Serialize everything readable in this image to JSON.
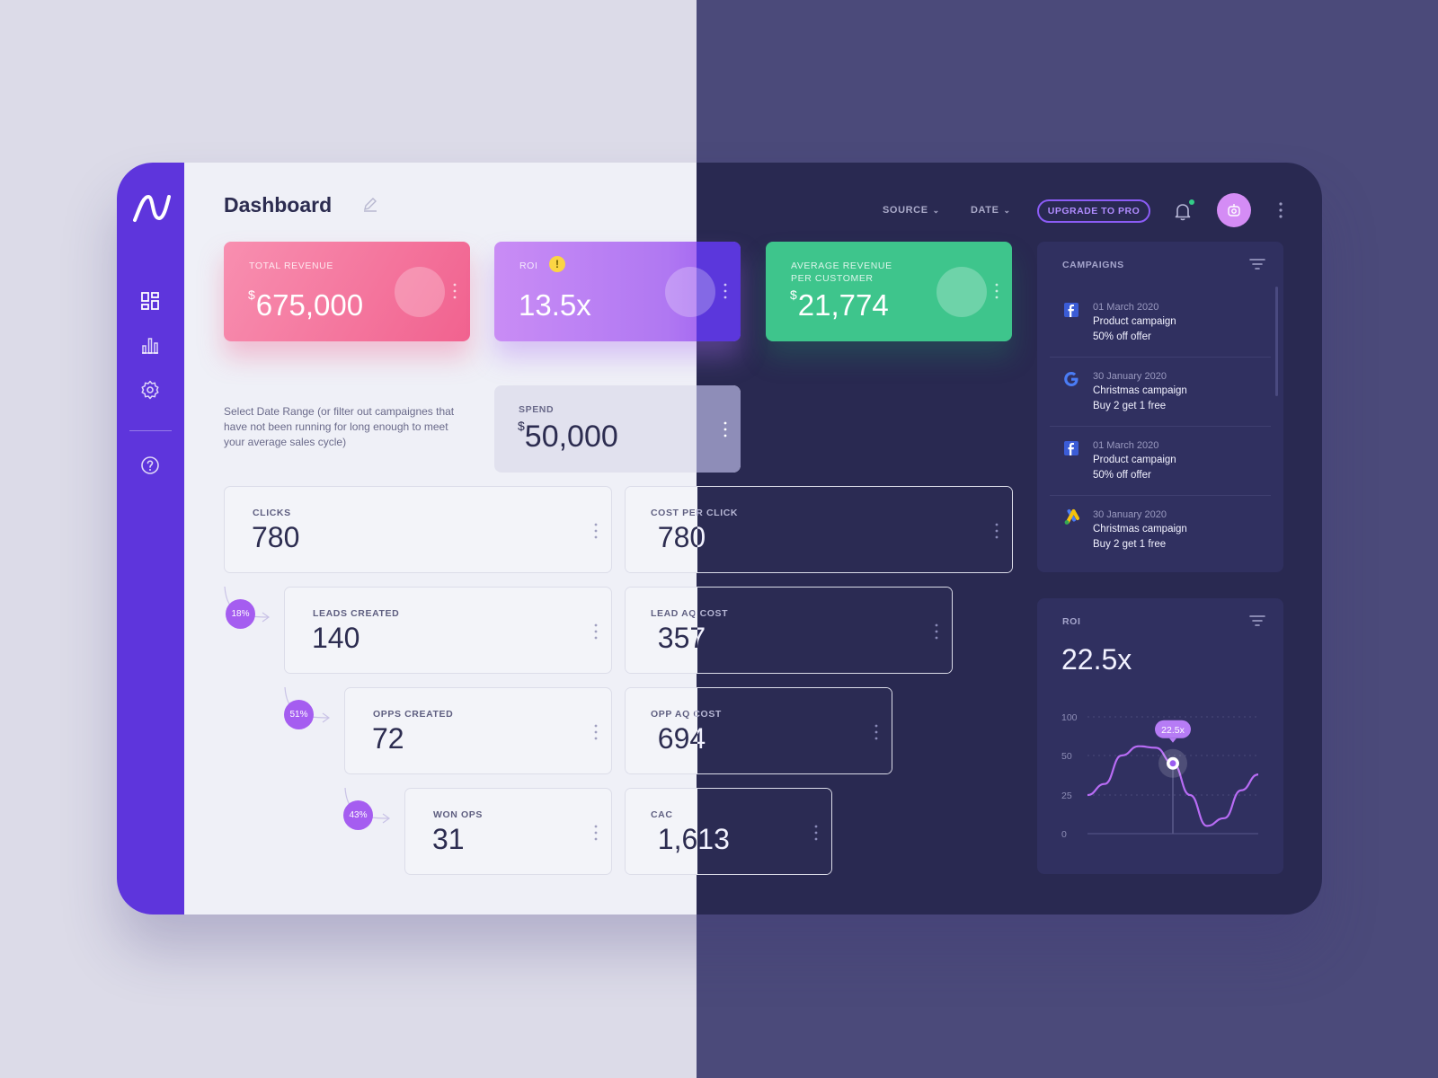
{
  "app": {
    "title": "Dashboard"
  },
  "header": {
    "source_label": "SOURCE",
    "date_label": "DATE",
    "upgrade_label": "UPGRADE TO PRO"
  },
  "sidebar": {
    "items": [
      {
        "icon": "dashboard-icon"
      },
      {
        "icon": "bar-chart-icon"
      },
      {
        "icon": "gear-icon"
      },
      {
        "icon": "help-icon"
      }
    ]
  },
  "kpis": {
    "total_revenue": {
      "label": "TOTAL REVENUE",
      "currency": "$",
      "value": "675,000"
    },
    "roi": {
      "label": "ROI",
      "value": "13.5x",
      "warning": "!"
    },
    "avg_revenue": {
      "label_line1": "AVERAGE REVENUE",
      "label_line2": "PER CUSTOMER",
      "currency": "$",
      "value": "21,774"
    }
  },
  "date_range_note": "Select Date Range (or filter out campaignes that have not been running for long enough to meet your average sales cycle)",
  "spend": {
    "label": "SPEND",
    "currency": "$",
    "value": "50,000"
  },
  "funnel": [
    {
      "label": "CLICKS",
      "value": "780"
    },
    {
      "label": "LEADS CREATED",
      "value": "140",
      "conversion": "18%"
    },
    {
      "label": "OPPS CREATED",
      "value": "72",
      "conversion": "51%"
    },
    {
      "label": "WON OPS",
      "value": "31",
      "conversion": "43%"
    }
  ],
  "costs": [
    {
      "label": "COST PER CLICK",
      "currency": "$",
      "value": "780"
    },
    {
      "label": "LEAD AQ COST",
      "currency": "$",
      "value": "357"
    },
    {
      "label": "OPP AQ COST",
      "currency": "$",
      "value": "694"
    },
    {
      "label": "CAC",
      "currency": "$",
      "value": "1,613"
    }
  ],
  "campaigns": {
    "title": "CAMPAIGNS",
    "items": [
      {
        "source_icon": "facebook-icon",
        "date": "01 March 2020",
        "name": "Product campaign",
        "offer": "50% off offer"
      },
      {
        "source_icon": "google-icon",
        "date": "30 January 2020",
        "name": "Christmas campaign",
        "offer": "Buy 2 get 1 free"
      },
      {
        "source_icon": "facebook-icon",
        "date": "01 March 2020",
        "name": "Product campaign",
        "offer": "50% off offer"
      },
      {
        "source_icon": "google-ads-icon",
        "date": "30 January 2020",
        "name": "Christmas campaign",
        "offer": "Buy 2 get 1 free"
      }
    ]
  },
  "roi_panel": {
    "title": "ROI",
    "value": "22.5x",
    "tooltip": "22.5x"
  },
  "chart_data": {
    "type": "line",
    "title": "ROI",
    "y_ticks": [
      "100",
      "50",
      "25",
      "0"
    ],
    "ylim": [
      0,
      100
    ],
    "series": [
      {
        "values": [
          25,
          32,
          50,
          62,
          60,
          45,
          25,
          5,
          10,
          28,
          38
        ]
      }
    ],
    "highlight_index": 5,
    "highlight_label": "22.5x",
    "grid": true
  },
  "colors": {
    "accent": "#5e35dc",
    "revenue": "#f1628f",
    "roi": "#b078f2",
    "avg_revenue": "#3ec58c",
    "line": "#b86cf5"
  }
}
